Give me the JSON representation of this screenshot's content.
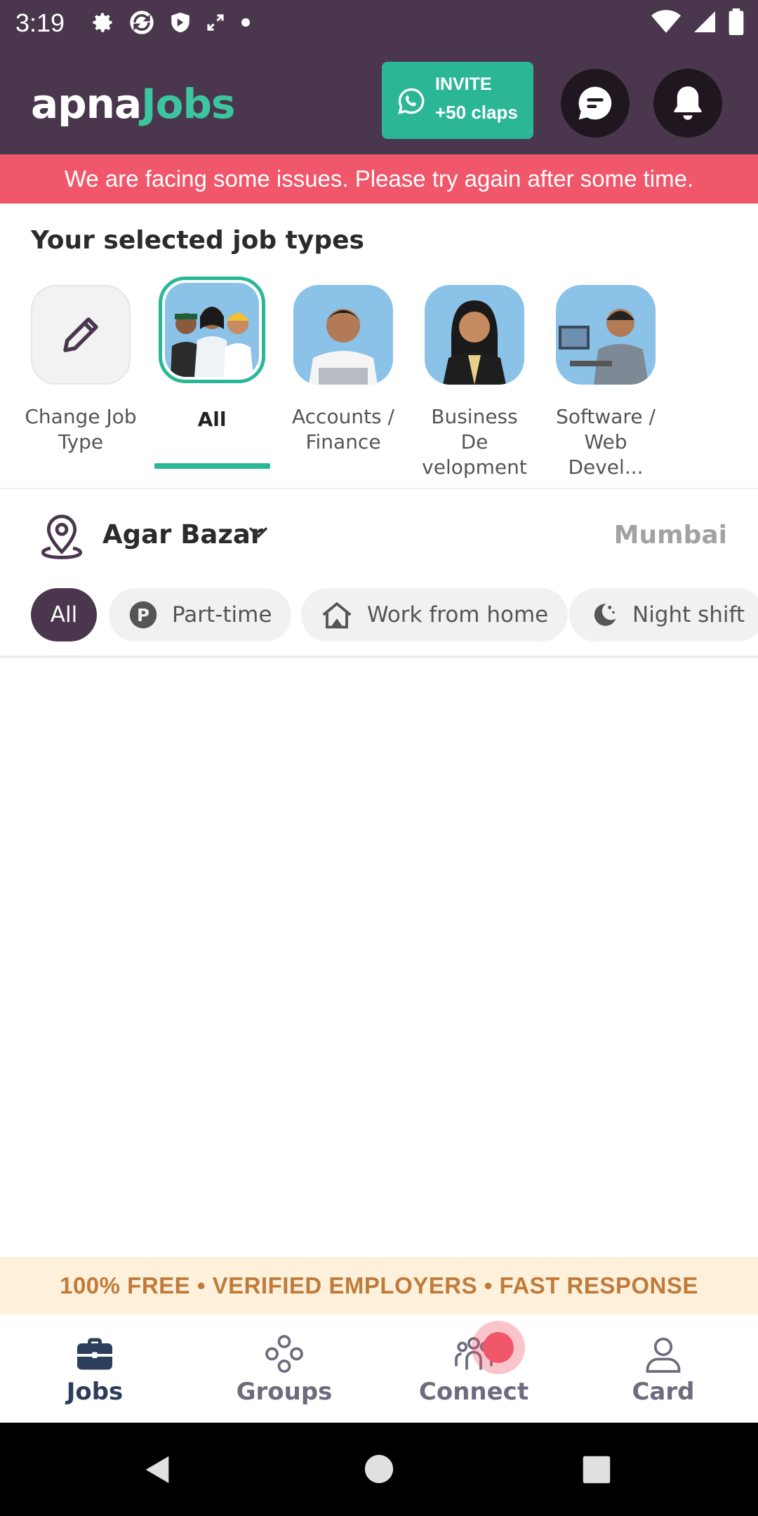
{
  "status_bar": {
    "time": "3:19",
    "left_icons": [
      "gear-icon",
      "sync-icon",
      "shield-icon",
      "expand-icon",
      "dot-icon"
    ],
    "right_icons": [
      "wifi-icon",
      "signal-icon",
      "battery-icon"
    ]
  },
  "header": {
    "logo_part1": "apna",
    "logo_part2": "Jobs",
    "invite_line1": "INVITE",
    "invite_line2": "+50 claps"
  },
  "error_banner": "We are facing some issues. Please try again after some time.",
  "job_types": {
    "title": "Your selected job types",
    "items": [
      {
        "line1": "Change Job",
        "line2": "Type"
      },
      {
        "line1": "All",
        "line2": ""
      },
      {
        "line1": "Accounts /",
        "line2": "Finance"
      },
      {
        "line1": "Business De",
        "line2": "velopment"
      },
      {
        "line1": "Software /",
        "line2": "Web Devel..."
      }
    ]
  },
  "location": {
    "area": "Agar Bazar",
    "city": "Mumbai"
  },
  "filters": [
    "All",
    "Part-time",
    "Work from home",
    "Night shift"
  ],
  "promo": "100% FREE • VERIFIED EMPLOYERS • FAST RESPONSE",
  "bottom_nav": [
    "Jobs",
    "Groups",
    "Connect",
    "Card"
  ],
  "colors": {
    "header_bg": "#4a374e",
    "accent_green": "#2bb796",
    "error_red": "#f0576a",
    "promo_bg": "#fdf1dc",
    "promo_text": "#c07b3a"
  }
}
